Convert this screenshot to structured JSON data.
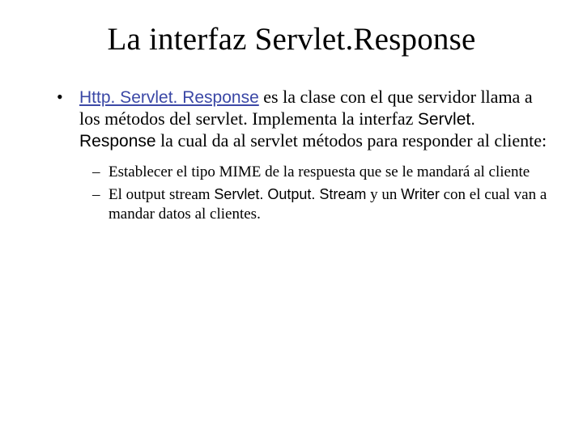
{
  "title": "La interfaz Servlet.Response",
  "bullet1": {
    "link": "Http. Servlet. Response",
    "text_after_link": "  es la clase con el que servidor llama a los métodos del servlet. Implementa la interfaz ",
    "api1": "Servlet. Response",
    "text_after_api1": " la cual da al servlet métodos para responder al cliente:"
  },
  "sub": [
    {
      "text": "Establecer el tipo MIME de la respuesta que se le mandará al cliente"
    },
    {
      "prefix": "El output stream ",
      "api_a": "Servlet. Output. Stream",
      "middle": " y un ",
      "api_b": "Writer",
      "suffix": " con el cual van a mandar datos al clientes."
    }
  ]
}
